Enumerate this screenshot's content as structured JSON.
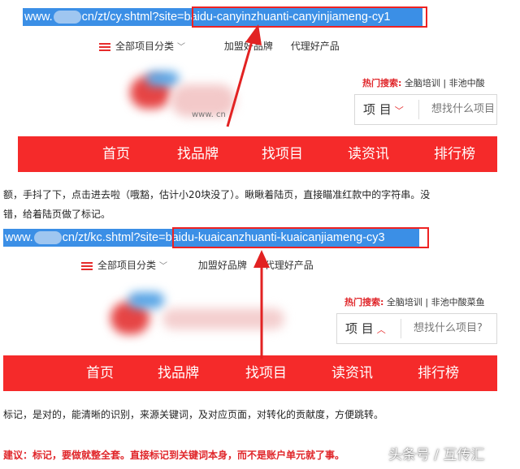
{
  "screenshot1": {
    "url_prefix": "www.",
    "url_mid": "cn/zt/cy.shtml?site=",
    "url_param": "baidu-canyinzhuanti-canyinjiameng-cy1",
    "subnav": {
      "all_categories": "全部项目分类",
      "brands": "加盟好品牌",
      "agency": "代理好产品"
    },
    "logo_text": "www.   cn",
    "hot_label": "热门搜索:",
    "hot_items": "全脑培训 | 非池中酸",
    "search_category": "项 目",
    "search_placeholder": "想找什么项目",
    "nav": [
      "首页",
      "找品牌",
      "找项目",
      "读资讯",
      "排行榜"
    ]
  },
  "paragraph1": {
    "line1": "额，手抖了下，点击进去啦（哦豁，估计小20块没了）。瞅瞅着陆页，直接瞄准红款中的字符串。没",
    "line2": "错，给着陆页做了标记。"
  },
  "screenshot2": {
    "url_prefix": "www.",
    "url_mid": "cn/zt/kc.shtml?site=",
    "url_param": "baidu-kuaicanzhuanti-kuaicanjiameng-cy3",
    "subnav": {
      "all_categories": "全部项目分类",
      "brands": "加盟好品牌",
      "agency": "代理好产品"
    },
    "hot_label": "热门搜索:",
    "hot_items": "全脑培训 | 非池中酸菜鱼",
    "search_category": "项 目",
    "search_placeholder": "想找什么项目?",
    "nav": [
      "首页",
      "找品牌",
      "找项目",
      "读资讯",
      "排行榜"
    ]
  },
  "paragraph2": "标记，是对的，能清晰的识别，来源关键词，及对应页面，对转化的贡献度，方便跳转。",
  "tip": "建议：标记，要做就整全套。直接标记到关键词本身，而不是账户单元就了事。",
  "watermark": "头条号 / 互传汇",
  "colors": {
    "accent_red": "#f52a2a",
    "highlight_blue": "#3b8fe6",
    "annotation_red": "#e22222"
  }
}
